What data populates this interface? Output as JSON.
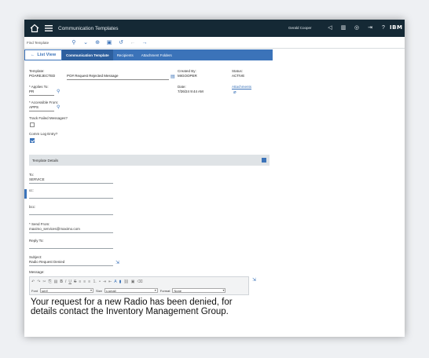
{
  "header": {
    "app_title": "Communication Templates",
    "user": "Gerald Cooper",
    "brand": "IBM",
    "icons": [
      "back-icon",
      "reports-icon",
      "workcenter-icon",
      "signout-icon",
      "help-icon"
    ]
  },
  "findbar": {
    "placeholder": "Find Template"
  },
  "tabs": {
    "list_view": "List View",
    "items": [
      "Communication Template",
      "Recipients",
      "Attachment Folders"
    ]
  },
  "form": {
    "template_label": "Template:",
    "template_value": "POAREJECTED",
    "description_value": "PO# Request Rejected Message",
    "created_by_label": "Created By:",
    "created_by_value": "MIGOOPER",
    "status_label": "Status:",
    "status_value": "ACTIVE",
    "applies_to_label": "* Applies To:",
    "applies_to_value": "PR",
    "date_label": "Date:",
    "date_value": "7/26/24 9:44 AM",
    "attachments_label": "Attachments",
    "accessible_from_label": "* Accessible From:",
    "accessible_from_value": "APPS",
    "track_failed_label": "Track Failed Messages?",
    "comm_log_label": "Comm Log Entry?"
  },
  "details": {
    "section_title": "Template Details",
    "to_label": "To:",
    "to_value": "SERVICE",
    "cc_label": "cc:",
    "bcc_label": "bcc:",
    "send_from_label": "* Send From:",
    "send_from_value": "maximo_services@maximo.com",
    "reply_to_label": "Reply To:",
    "subject_label": "Subject:",
    "subject_value": "Radio Request Denied",
    "message_label": "Message:",
    "font_label": "Font",
    "font_value": "serif",
    "size_label": "Size",
    "size_value": "x-small",
    "format_label": "Format",
    "format_value": "None",
    "message_body": "Your request for a new Radio has been denied, for details contact the Inventory Management Group."
  },
  "colors": {
    "nav": "#152935",
    "accent": "#3b73b9"
  }
}
